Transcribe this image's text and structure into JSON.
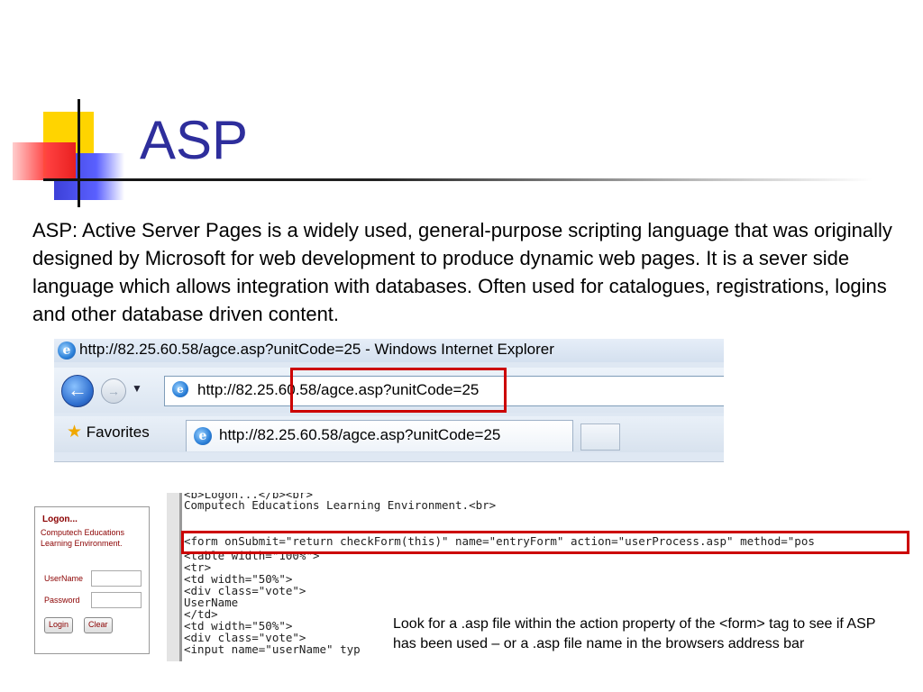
{
  "slide": {
    "title": "ASP",
    "body": "ASP: Active Server Pages is a widely used, general-purpose scripting language that was originally designed by Microsoft for web development to produce dynamic web pages. It is a sever side language which allows integration with databases. Often used for catalogues, registrations, logins and other database driven content."
  },
  "browser": {
    "window_title": "http://82.25.60.58/agce.asp?unitCode=25 - Windows Internet Explorer",
    "address": "http://82.25.60.58/agce.asp?unitCode=25",
    "favorites_label": "Favorites",
    "tab_label": "http://82.25.60.58/agce.asp?unitCode=25",
    "back_icon": "back-arrow-icon",
    "forward_icon": "forward-arrow-icon",
    "favorites_icon": "star-icon"
  },
  "form": {
    "title": "Logon...",
    "subtitle": "Computech    Educations Learning Environment.",
    "username_label": "UserName",
    "password_label": "Password",
    "login_button": "Login",
    "clear_button": "Clear"
  },
  "code": {
    "lines": [
      "<b>Logon...</b><br>",
      "Computech Educations Learning Environment.<br>",
      "",
      "<form onSubmit=\"return checkForm(this)\" name=\"entryForm\" action=\"userProcess.asp\" method=\"pos",
      "<table width=\"100%\">",
      "<tr>",
      "<td width=\"50%\">",
      "<div class=\"vote\">",
      "UserName",
      "</td>",
      "<td width=\"50%\">",
      "<div class=\"vote\">",
      "<input name=\"userName\" typ"
    ]
  },
  "note": "Look for a  .asp file within the action property of the <form> tag to see if ASP has been used – or a .asp file name in the browsers address bar",
  "colors": {
    "title": "#2e2e9c",
    "highlight_box": "#cc0000",
    "form_text": "#8b0000"
  }
}
